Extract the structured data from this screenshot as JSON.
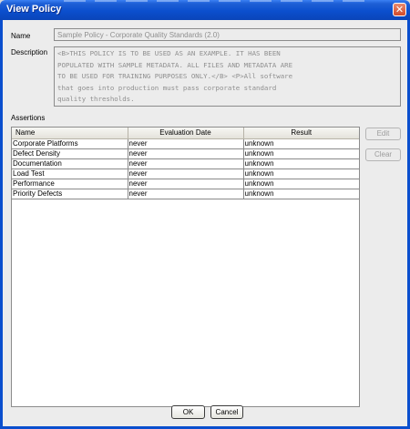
{
  "window": {
    "title": "View Policy"
  },
  "form": {
    "name_label": "Name",
    "name_value": "Sample Policy - Corporate Quality Standards (2.0)",
    "description_label": "Description",
    "description_lines": [
      "<B>THIS POLICY IS TO BE USED AS AN EXAMPLE. IT HAS BEEN",
      "POPULATED WITH SAMPLE METADATA. ALL FILES AND METADATA ARE",
      "TO BE USED FOR TRAINING PURPOSES ONLY.</B> <P>All software",
      "that goes into production must pass corporate standard",
      "quality thresholds."
    ]
  },
  "assertions": {
    "label": "Assertions",
    "columns": [
      "Name",
      "Evaluation Date",
      "Result"
    ],
    "rows": [
      [
        "Corporate Platforms",
        "never",
        "unknown"
      ],
      [
        "Defect Density",
        "never",
        "unknown"
      ],
      [
        "Documentation",
        "never",
        "unknown"
      ],
      [
        "Load Test",
        "never",
        "unknown"
      ],
      [
        "Performance",
        "never",
        "unknown"
      ],
      [
        "Priority Defects",
        "never",
        "unknown"
      ]
    ],
    "edit_label": "Edit",
    "clear_label": "Clear"
  },
  "footer": {
    "ok_label": "OK",
    "cancel_label": "Cancel"
  },
  "colors": {
    "titlebar": "#0b4fce",
    "dialog_bg": "#ececec",
    "close_button": "#d24b2a"
  }
}
